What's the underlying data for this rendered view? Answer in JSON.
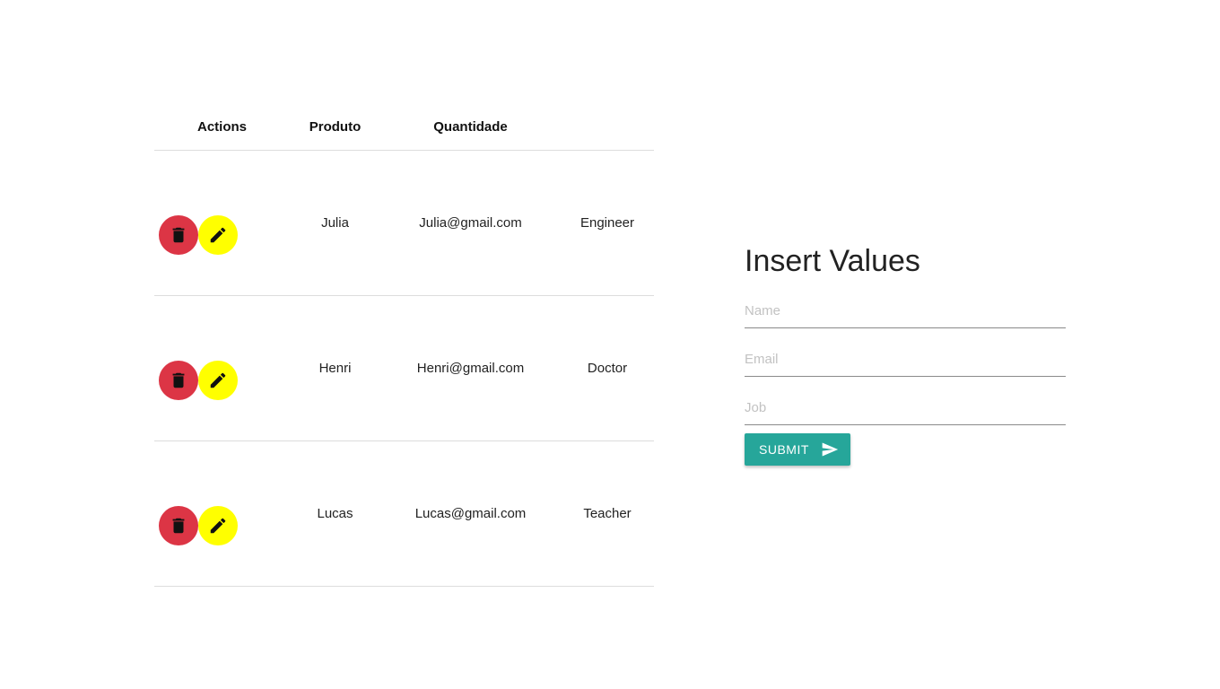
{
  "table": {
    "headers": {
      "actions": "Actions",
      "produto": "Produto",
      "quantidade": "Quantidade"
    },
    "rows": [
      {
        "name": "Julia",
        "email": "Julia@gmail.com",
        "job": "Engineer"
      },
      {
        "name": "Henri",
        "email": "Henri@gmail.com",
        "job": "Doctor"
      },
      {
        "name": "Lucas",
        "email": "Lucas@gmail.com",
        "job": "Teacher"
      }
    ],
    "delete_icon": "trash-icon",
    "edit_icon": "pencil-icon"
  },
  "form": {
    "title": "Insert Values",
    "name_placeholder": "Name",
    "email_placeholder": "Email",
    "job_placeholder": "Job",
    "submit_label": "SUBMIT",
    "submit_icon": "send-icon"
  },
  "colors": {
    "delete": "#dc3545",
    "edit": "#ffff00",
    "submit": "#26a69a"
  }
}
